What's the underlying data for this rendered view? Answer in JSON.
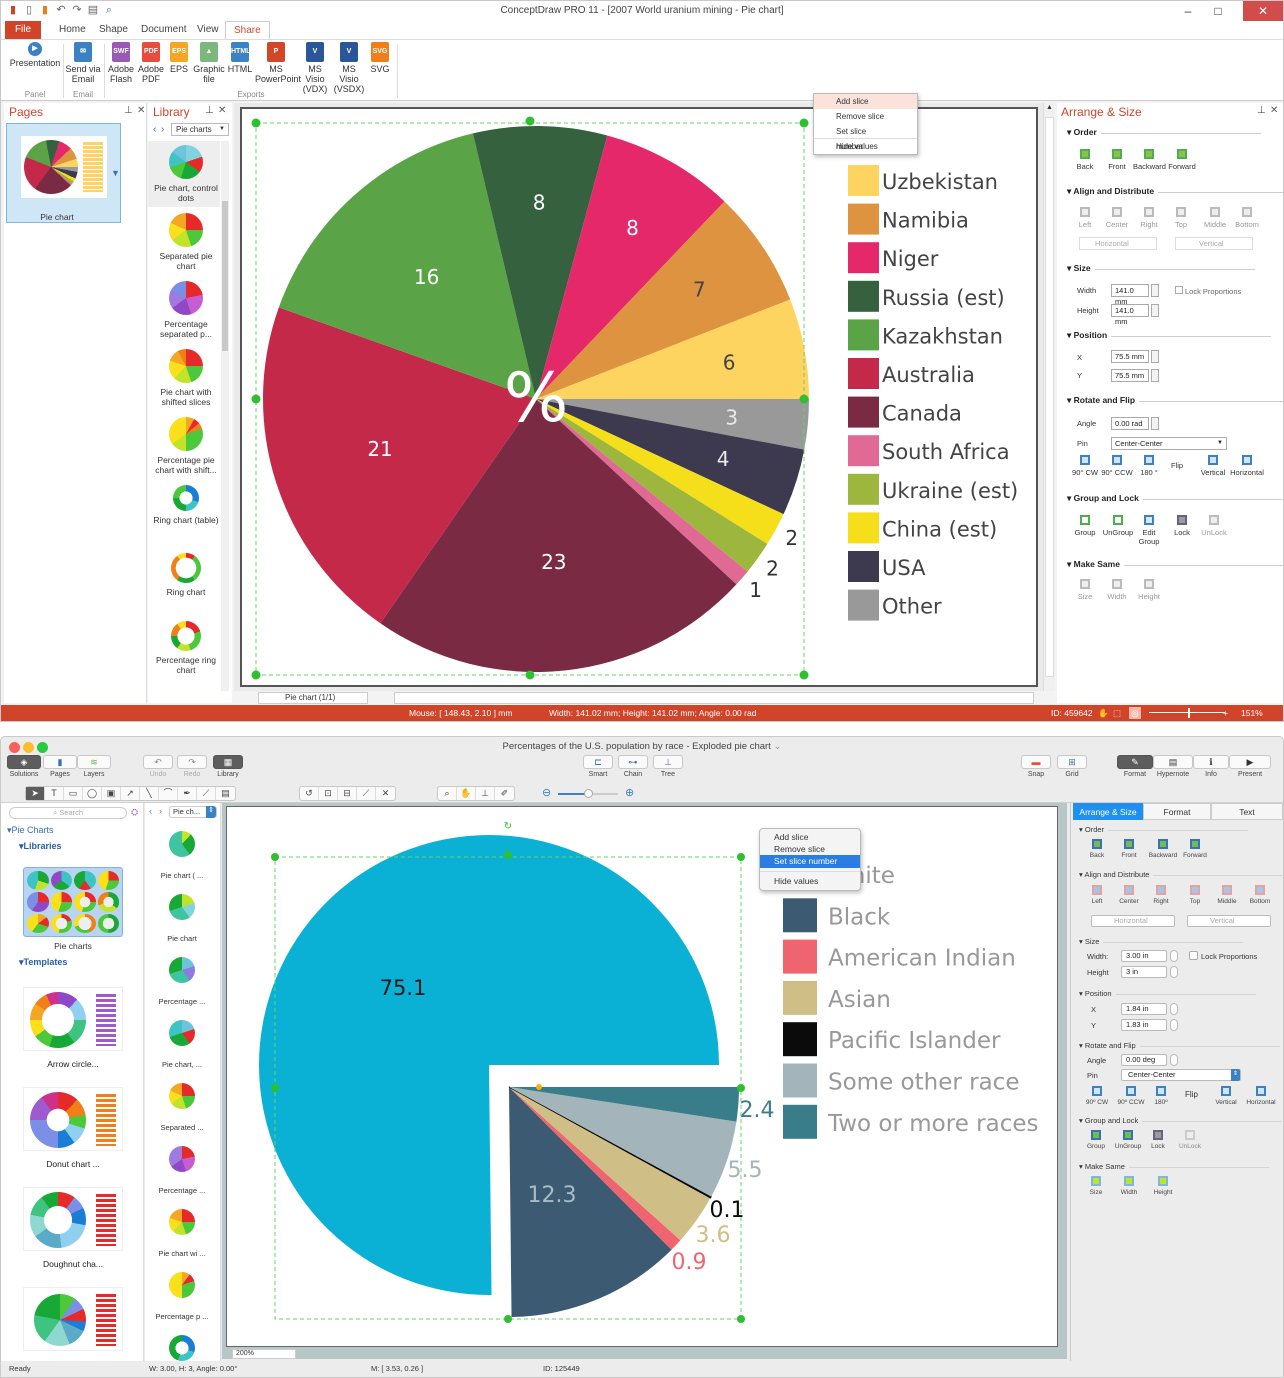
{
  "windows_app": {
    "title": "ConceptDraw PRO 11 - [2007 World uranium mining - Pie chart]",
    "ribbon_tabs": [
      "File",
      "Home",
      "Shape",
      "Document",
      "View",
      "Share"
    ],
    "active_tab": "Share",
    "ribbon_buttons": [
      {
        "label": "Presentation",
        "icon": "presentation-icon",
        "group": "Panel"
      },
      {
        "label": "Send via Email",
        "icon": "email-icon",
        "group": "Email"
      },
      {
        "label": "Adobe Flash",
        "icon": "swf-icon",
        "group": "Exports"
      },
      {
        "label": "Adobe PDF",
        "icon": "pdf-icon",
        "group": "Exports"
      },
      {
        "label": "EPS",
        "icon": "eps-icon",
        "group": "Exports"
      },
      {
        "label": "Graphic file",
        "icon": "image-icon",
        "group": "Exports"
      },
      {
        "label": "HTML",
        "icon": "html-icon",
        "group": "Exports"
      },
      {
        "label": "MS PowerPoint",
        "icon": "powerpoint-icon",
        "group": "Exports"
      },
      {
        "label": "MS Visio (VDX)",
        "icon": "visio-icon",
        "group": "Exports"
      },
      {
        "label": "MS Visio (VSDX)",
        "icon": "visio-icon",
        "group": "Exports"
      },
      {
        "label": "SVG",
        "icon": "svg-icon",
        "group": "Exports"
      }
    ],
    "ribbon_groups": [
      "Panel",
      "Email",
      "Exports"
    ],
    "pages_panel": {
      "title": "Pages",
      "page_label": "Pie chart"
    },
    "library_panel": {
      "title": "Library",
      "selected": "Pie charts",
      "items": [
        "Pie chart, control dots",
        "Separated pie chart",
        "Percentage separated p...",
        "Pie chart with shifted slices",
        "Percentage pie chart with shift...",
        "Ring chart (table)",
        "Ring chart",
        "Percentage ring chart"
      ]
    },
    "context_menu": {
      "items": [
        "Add slice",
        "Remove slice",
        "Set slice number",
        "Hide values"
      ],
      "highlighted": "Add slice"
    },
    "page_tab": "Pie chart (1/1)",
    "arrange_panel": {
      "title": "Arrange & Size",
      "order": {
        "label": "Order",
        "buttons": [
          "Back",
          "Front",
          "Backward",
          "Forward"
        ]
      },
      "align": {
        "label": "Align and Distribute",
        "buttons": [
          "Left",
          "Center",
          "Right",
          "Top",
          "Middle",
          "Bottom"
        ],
        "horizontal": "Horizontal",
        "vertical": "Vertical"
      },
      "size": {
        "label": "Size",
        "width_label": "Width",
        "width": "141.0 mm",
        "height_label": "Height",
        "height": "141.0 mm",
        "lock": "Lock Proportions"
      },
      "position": {
        "label": "Position",
        "x_label": "X",
        "x": "75.5 mm",
        "y_label": "Y",
        "y": "75.5 mm"
      },
      "rotate": {
        "label": "Rotate and Flip",
        "angle_label": "Angle",
        "angle": "0.00 rad",
        "pin_label": "Pin",
        "pin": "Center-Center",
        "buttons": [
          "90° CW",
          "90° CCW",
          "180 °",
          "Flip",
          "Vertical",
          "Horizontal"
        ]
      },
      "group": {
        "label": "Group and Lock",
        "buttons": [
          "Group",
          "UnGroup",
          "Edit Group",
          "Lock",
          "UnLock"
        ]
      },
      "same": {
        "label": "Make Same",
        "buttons": [
          "Size",
          "Width",
          "Height"
        ]
      }
    },
    "status": {
      "mouse": "Mouse: [ 148.43, 2.10 ] mm",
      "dims": "Width: 141.02 mm;  Height: 141.02 mm;  Angle: 0.00 rad",
      "id": "ID: 459642",
      "zoom": "151%"
    }
  },
  "mac_app": {
    "title": "Percentages of the U.S. population by race - Exploded pie chart",
    "toolbar_left": [
      "Solutions",
      "Pages",
      "Layers",
      "Undo",
      "Redo",
      "Library"
    ],
    "toolbar_mid": [
      "Smart",
      "Chain",
      "Tree"
    ],
    "toolbar_right": [
      "Snap",
      "Grid",
      "Format",
      "Hypernote",
      "Info",
      "Present"
    ],
    "search_placeholder": "Search",
    "tree": {
      "root": "Pie Charts",
      "libraries": "Libraries",
      "library_item": "Pie charts",
      "templates": "Templates"
    },
    "templates": [
      "Arrow circle...",
      "Donut chart ...",
      "Doughnut cha..."
    ],
    "library_selected": "Pie ch...",
    "library_items": [
      "Pie chart ( ...",
      "Pie chart",
      "Percentage ...",
      "Pie chart, ...",
      "Separated ...",
      "Percentage ...",
      "Pie chart wi ...",
      "Percentage p ..."
    ],
    "context_menu": {
      "items": [
        "Add slice",
        "Remove slice",
        "Set slice number",
        "Hide values"
      ],
      "highlighted": "Set slice number"
    },
    "zoom_field": "200%",
    "right_tabs": [
      "Arrange & Size",
      "Format",
      "Text"
    ],
    "arrange": {
      "order": {
        "label": "Order",
        "buttons": [
          "Back",
          "Front",
          "Backward",
          "Forward"
        ]
      },
      "align": {
        "label": "Align and Distribute",
        "buttons": [
          "Left",
          "Center",
          "Right",
          "Top",
          "Middle",
          "Bottom"
        ],
        "horizontal": "Horizontal",
        "vertical": "Vertical"
      },
      "size": {
        "label": "Size",
        "width_label": "Width:",
        "width": "3.00 in",
        "height_label": "Height",
        "height": "3 in",
        "lock": "Lock Proportions"
      },
      "position": {
        "label": "Position",
        "x_label": "X",
        "x": "1.84 in",
        "y_label": "Y",
        "y": "1.83 in"
      },
      "rotate": {
        "label": "Rotate and Flip",
        "angle_label": "Angle",
        "angle": "0.00 deg",
        "pin_label": "Pin",
        "pin": "Center-Center",
        "buttons": [
          "90º CW",
          "90º CCW",
          "180º",
          "Flip",
          "Vertical",
          "Horizontal"
        ]
      },
      "group": {
        "label": "Group and Lock",
        "buttons": [
          "Group",
          "UnGroup",
          "Lock",
          "UnLock"
        ]
      },
      "same": {
        "label": "Make Same",
        "buttons": [
          "Size",
          "Width",
          "Height"
        ]
      }
    },
    "status": {
      "ready": "Ready",
      "dims": "W: 3.00,  H: 3,  Angle: 0.00°",
      "mouse": "M: [ 3.53, 0.26 ]",
      "id": "ID: 125449"
    }
  },
  "chart_data": [
    {
      "type": "pie",
      "title": "2007 World uranium mining",
      "center_label": "%",
      "categories": [
        "Other",
        "USA",
        "China (est)",
        "Ukraine (est)",
        "South Africa",
        "Canada",
        "Australia",
        "Kazakhstan",
        "Russia (est)",
        "Niger",
        "Namibia",
        "Uzbekistan"
      ],
      "values": [
        3,
        4,
        2,
        2,
        1,
        23,
        21,
        16,
        8,
        8,
        7,
        6
      ],
      "colors": [
        "#999999",
        "#3d3a50",
        "#f5df1a",
        "#9db63d",
        "#e06a94",
        "#7a2a42",
        "#c4294a",
        "#5aa447",
        "#35613f",
        "#e5286a",
        "#de9340",
        "#fdd460"
      ],
      "legend": [
        "Uzbekistan",
        "Namibia",
        "Niger",
        "Russia (est)",
        "Kazakhstan",
        "Australia",
        "Canada",
        "South Africa",
        "Ukraine (est)",
        "China (est)",
        "USA",
        "Other"
      ],
      "legend_colors": [
        "#fdd460",
        "#de9340",
        "#e5286a",
        "#35613f",
        "#5aa447",
        "#c4294a",
        "#7a2a42",
        "#e06a94",
        "#9db63d",
        "#f5df1a",
        "#3d3a50",
        "#999999"
      ],
      "legend_position": "right"
    },
    {
      "type": "pie",
      "title": "Percentages of the U.S. population by race",
      "exploded": "all slices except White pulled out together",
      "categories": [
        "White",
        "Black",
        "American Indian",
        "Asian",
        "Pacific Islander",
        "Some other race",
        "Two or more races"
      ],
      "values": [
        75.1,
        12.3,
        0.9,
        3.6,
        0.1,
        5.5,
        2.4
      ],
      "colors": [
        "#0bb0d5",
        "#3d5a73",
        "#ee6570",
        "#cfbf86",
        "#0b0b0b",
        "#a3b5ba",
        "#3a7d8a"
      ],
      "label_colors": [
        "#1a1a1a",
        "#a9bcc4",
        "#ee6570",
        "#cfbf86",
        "#0b0b0b",
        "#a3b5ba",
        "#3a7d8a"
      ],
      "legend": [
        "White",
        "Black",
        "American Indian",
        "Asian",
        "Pacific Islander",
        "Some other race",
        "Two or more races"
      ],
      "legend_position": "right"
    }
  ]
}
